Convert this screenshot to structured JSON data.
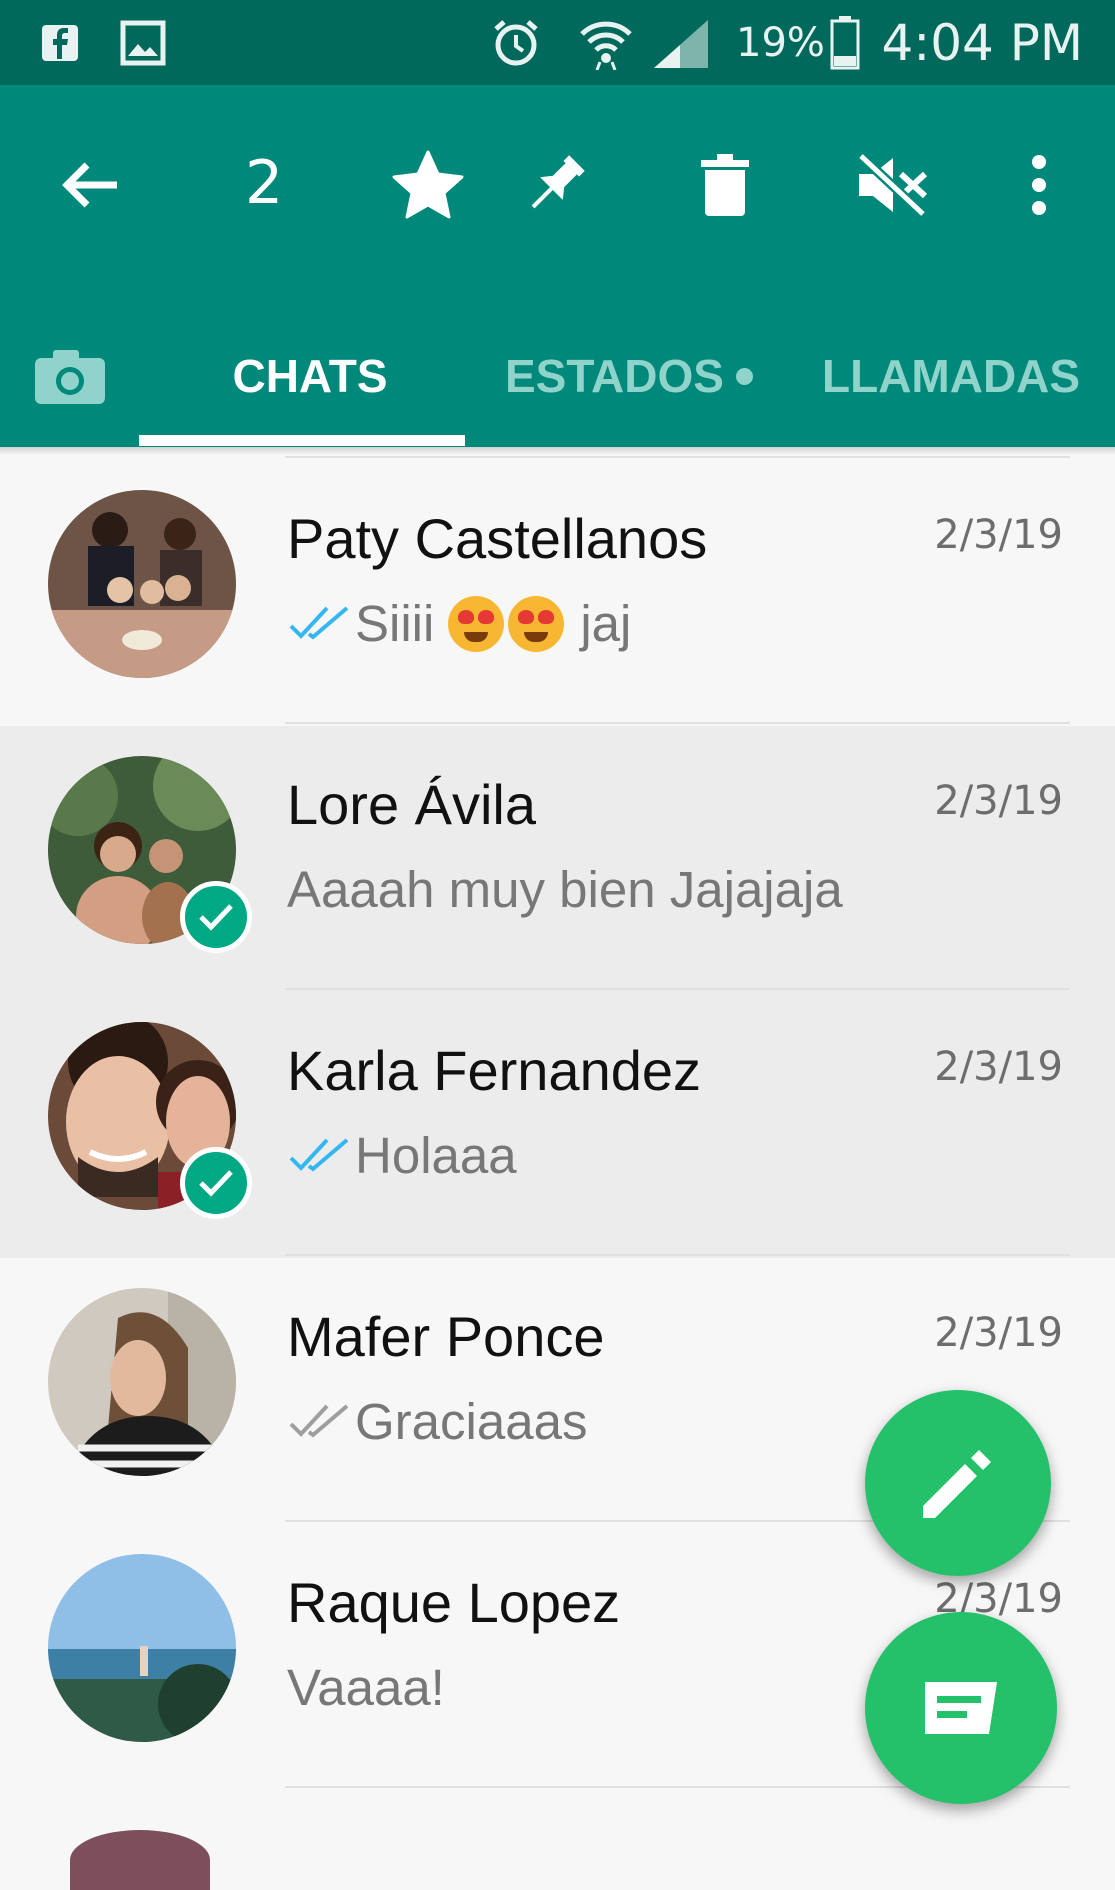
{
  "status_bar": {
    "battery_percent": "19%",
    "time": "4:04 PM",
    "icons": [
      "facebook-icon",
      "gallery-icon",
      "alarm-icon",
      "wifi-icon",
      "signal-icon",
      "battery-icon"
    ]
  },
  "toolbar": {
    "selected_count": "2",
    "icons": [
      "back-arrow-icon",
      "star-icon",
      "pin-icon",
      "trash-icon",
      "mute-icon",
      "more-vert-icon"
    ]
  },
  "tabs": [
    {
      "label": "CHATS",
      "active": true
    },
    {
      "label": "ESTADOS",
      "active": false,
      "has_dot": true
    },
    {
      "label": "LLAMADAS",
      "active": false
    }
  ],
  "chats": [
    {
      "name": "Paty Castellanos",
      "date": "2/3/19",
      "preview": "Siiii",
      "preview_suffix": "jaj",
      "ticks": "read",
      "selected": false
    },
    {
      "name": "Lore Ávila",
      "date": "2/3/19",
      "preview": "Aaaah muy bien Jajajaja",
      "ticks": "none",
      "selected": true
    },
    {
      "name": "Karla Fernandez",
      "date": "2/3/19",
      "preview": "Holaaa",
      "ticks": "read",
      "selected": true
    },
    {
      "name": "Mafer Ponce",
      "date": "2/3/19",
      "preview": "Graciaaas",
      "ticks": "delivered",
      "selected": false
    },
    {
      "name": "Raque Lopez",
      "date": "2/3/19",
      "preview": "Vaaaa!",
      "ticks": "none",
      "selected": false
    }
  ],
  "colors": {
    "status_bar": "#00695c",
    "app_bar": "#00897b",
    "fab": "#25c16a",
    "read_ticks": "#34b7f1",
    "select_check": "#00a884"
  }
}
